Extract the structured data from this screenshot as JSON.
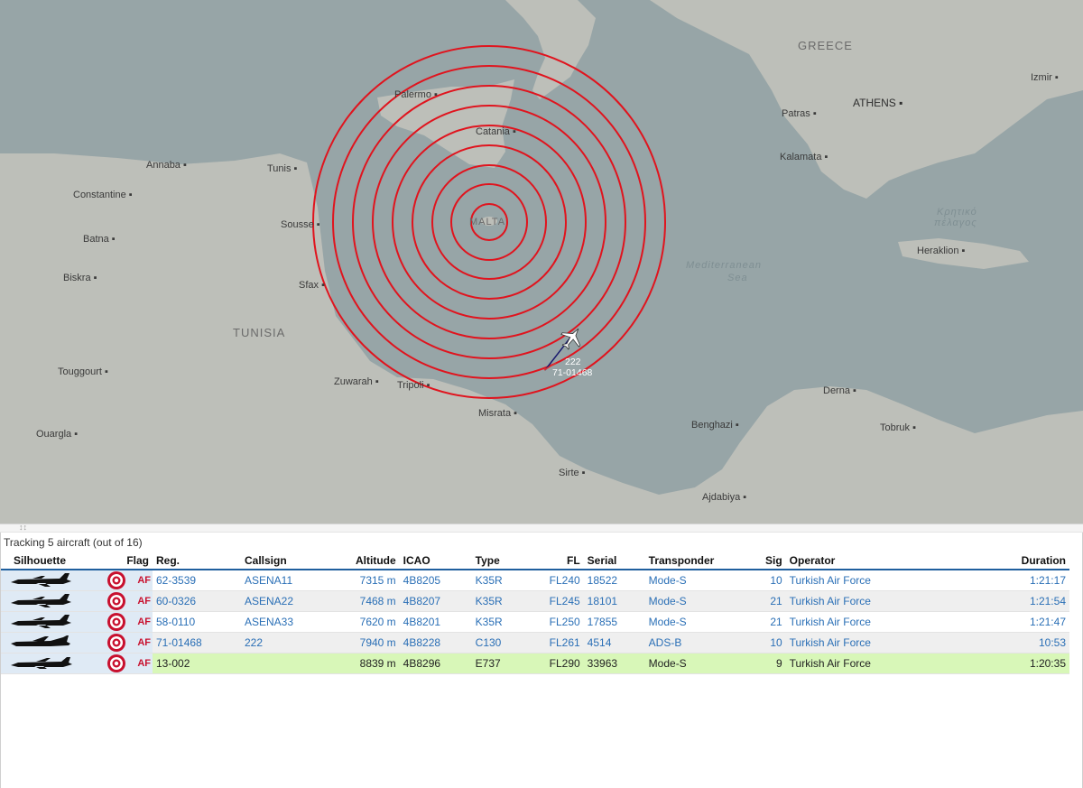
{
  "map": {
    "labels": {
      "greece": "GREECE",
      "tunisia": "TUNISIA",
      "malta": "MALTA",
      "sea1": "Mediterranean",
      "sea2": "Sea",
      "kritiko1": "Κρητικό",
      "kritiko2": "πέλαγος"
    },
    "cities": [
      "Palermo",
      "Catania",
      "Tunis",
      "Annaba",
      "Constantine",
      "Batna",
      "Biskra",
      "Sousse",
      "Sfax",
      "Touggourt",
      "Ouargla",
      "Zuwarah",
      "Tripoli",
      "Misrata",
      "Sirte",
      "Ajdabiya",
      "Benghazi",
      "Derna",
      "Tobruk",
      "Heraklion",
      "Kalamata",
      "Patras",
      "ATHENS",
      "Izmir"
    ],
    "aircraft": {
      "callsign": "222",
      "registration": "71-01468"
    },
    "ring_color": "#e0141e"
  },
  "status": {
    "tracking": "Tracking 5 aircraft (out of 16)"
  },
  "table": {
    "headers": {
      "silhouette": "Silhouette",
      "flag": "Flag",
      "reg": "Reg.",
      "callsign": "Callsign",
      "altitude": "Altitude",
      "icao": "ICAO",
      "type": "Type",
      "fl": "FL",
      "serial": "Serial",
      "transponder": "Transponder",
      "sig": "Sig",
      "operator": "Operator",
      "duration": "Duration"
    },
    "flag_text": "AF",
    "rows": [
      {
        "reg": "62-3539",
        "callsign": "ASENA11",
        "altitude": "7315 m",
        "icao": "4B8205",
        "type": "K35R",
        "fl": "FL240",
        "serial": "18522",
        "transponder": "Mode-S",
        "sig": "10",
        "operator": "Turkish Air Force",
        "duration": "1:21:17"
      },
      {
        "reg": "60-0326",
        "callsign": "ASENA22",
        "altitude": "7468 m",
        "icao": "4B8207",
        "type": "K35R",
        "fl": "FL245",
        "serial": "18101",
        "transponder": "Mode-S",
        "sig": "21",
        "operator": "Turkish Air Force",
        "duration": "1:21:54"
      },
      {
        "reg": "58-0110",
        "callsign": "ASENA33",
        "altitude": "7620 m",
        "icao": "4B8201",
        "type": "K35R",
        "fl": "FL250",
        "serial": "17855",
        "transponder": "Mode-S",
        "sig": "21",
        "operator": "Turkish Air Force",
        "duration": "1:21:47"
      },
      {
        "reg": "71-01468",
        "callsign": "222",
        "altitude": "7940 m",
        "icao": "4B8228",
        "type": "C130",
        "fl": "FL261",
        "serial": "4514",
        "transponder": "ADS-B",
        "sig": "10",
        "operator": "Turkish Air Force",
        "duration": "10:53"
      },
      {
        "reg": "13-002",
        "callsign": "",
        "altitude": "8839 m",
        "icao": "4B8296",
        "type": "E737",
        "fl": "FL290",
        "serial": "33963",
        "transponder": "Mode-S",
        "sig": "9",
        "operator": "Turkish Air Force",
        "duration": "1:20:35"
      }
    ]
  }
}
